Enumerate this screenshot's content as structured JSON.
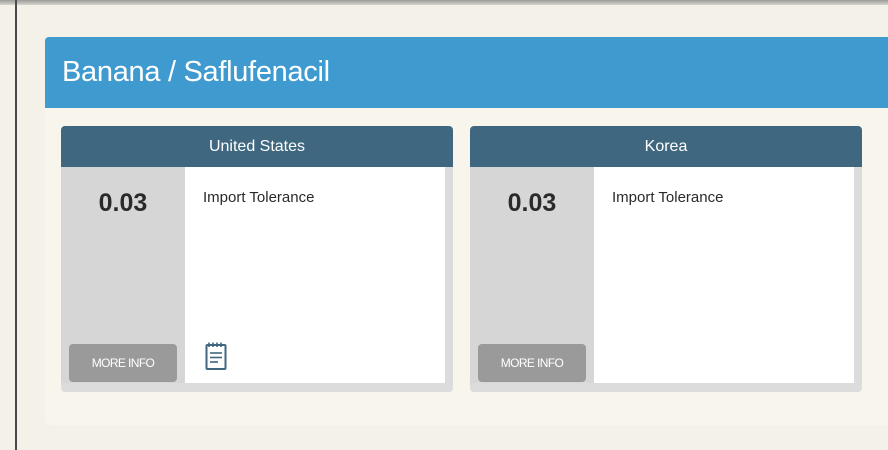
{
  "panel": {
    "title": "Banana / Saflufenacil"
  },
  "cards": [
    {
      "country": "United States",
      "value": "0.03",
      "text": "Import Tolerance",
      "more_info_label": "MORE INFO",
      "icon": "notepad-icon"
    },
    {
      "country": "Korea",
      "value": "0.03",
      "text": "Import Tolerance",
      "more_info_label": "MORE INFO"
    }
  ],
  "colors": {
    "page_background": "#f4f1e8",
    "panel_header": "#3f9ad0",
    "card_header": "#3f6880",
    "value_column": "#d6d6d6",
    "more_info_button": "#9a9a9a"
  }
}
